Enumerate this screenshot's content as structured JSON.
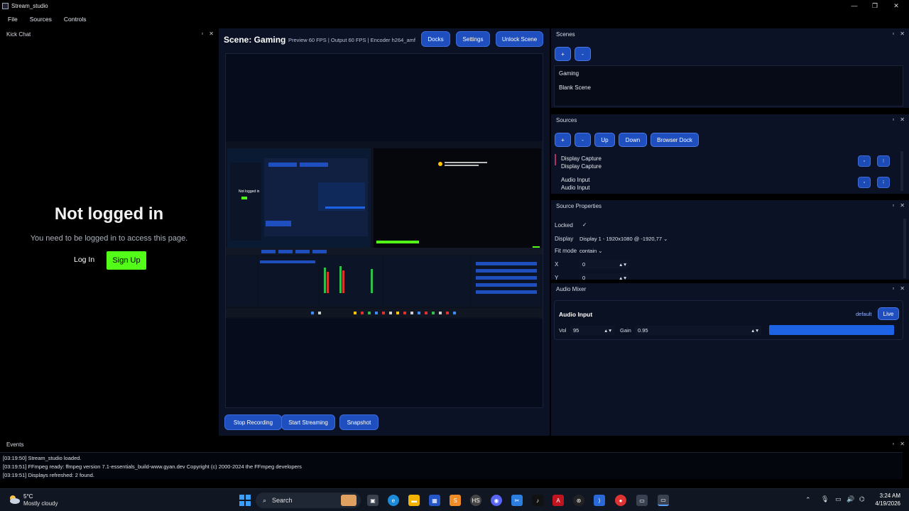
{
  "window": {
    "title": "Stream_studio"
  },
  "menu": [
    "File",
    "Sources",
    "Controls"
  ],
  "kick": {
    "panel_title": "Kick Chat",
    "heading": "Not logged in",
    "message": "You need to be logged in to access this page.",
    "login": "Log In",
    "signup": "Sign Up",
    "signup_color": "#53fc18"
  },
  "center": {
    "scene_title": "Scene: Gaming",
    "stats": "Preview 60 FPS | Output 60 FPS | Encoder h264_amf",
    "buttons": {
      "docks": "Docks",
      "settings": "Settings",
      "unlock": "Unlock Scene"
    },
    "bottom": {
      "stop_recording": "Stop Recording",
      "start_streaming": "Start Streaming",
      "snapshot": "Snapshot"
    }
  },
  "scenes": {
    "title": "Scenes",
    "add": "+",
    "remove": "-",
    "items": [
      "Gaming",
      "Blank Scene"
    ]
  },
  "sources": {
    "title": "Sources",
    "buttons": [
      "+",
      "-",
      "Up",
      "Down",
      "Browser Dock"
    ],
    "items": [
      {
        "name": "Display Capture",
        "type": "Display Capture"
      },
      {
        "name": "Audio Input",
        "type": "Audio Input"
      }
    ]
  },
  "properties": {
    "title": "Source Properties",
    "locked_label": "Locked",
    "locked_check": "✓",
    "display_label": "Display",
    "display_value": "Display 1 - 1920x1080 @ -1920,77",
    "fit_label": "Fit mode",
    "fit_value": "contain",
    "x_label": "X",
    "x_value": "0",
    "y_label": "Y",
    "y_value": "0"
  },
  "mixer": {
    "title": "Audio Mixer",
    "channel": "Audio Input",
    "device": "default",
    "live": "Live",
    "vol_label": "Vol",
    "vol_value": "95",
    "gain_label": "Gain",
    "gain_value": "0.95",
    "level_color": "#1e63e6"
  },
  "events": {
    "title": "Events",
    "lines": [
      "[03:19:50] Stream_studio loaded.",
      "[03:19:51] FFmpeg ready: ffmpeg version 7.1-essentials_build-www.gyan.dev Copyright (c) 2000-2024 the FFmpeg developers",
      "[03:19:51] Displays refreshed: 2 found."
    ]
  },
  "taskbar": {
    "weather_temp": "5°C",
    "weather_desc": "Mostly cloudy",
    "search": "Search",
    "time": "3:24 AM",
    "date": "4/19/2026"
  }
}
